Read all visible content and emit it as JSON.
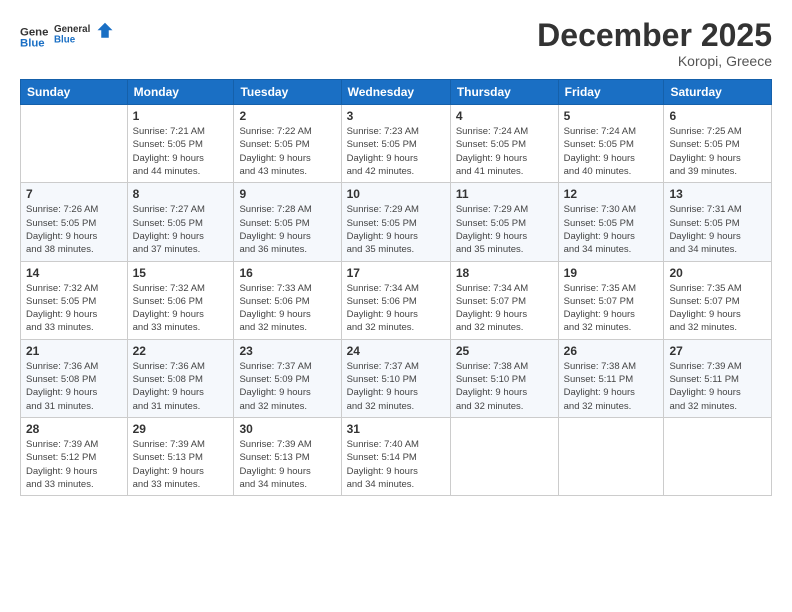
{
  "logo": {
    "line1": "General",
    "line2": "Blue"
  },
  "header": {
    "month": "December 2025",
    "location": "Koropi, Greece"
  },
  "weekdays": [
    "Sunday",
    "Monday",
    "Tuesday",
    "Wednesday",
    "Thursday",
    "Friday",
    "Saturday"
  ],
  "weeks": [
    [
      {
        "day": "",
        "info": ""
      },
      {
        "day": "1",
        "info": "Sunrise: 7:21 AM\nSunset: 5:05 PM\nDaylight: 9 hours\nand 44 minutes."
      },
      {
        "day": "2",
        "info": "Sunrise: 7:22 AM\nSunset: 5:05 PM\nDaylight: 9 hours\nand 43 minutes."
      },
      {
        "day": "3",
        "info": "Sunrise: 7:23 AM\nSunset: 5:05 PM\nDaylight: 9 hours\nand 42 minutes."
      },
      {
        "day": "4",
        "info": "Sunrise: 7:24 AM\nSunset: 5:05 PM\nDaylight: 9 hours\nand 41 minutes."
      },
      {
        "day": "5",
        "info": "Sunrise: 7:24 AM\nSunset: 5:05 PM\nDaylight: 9 hours\nand 40 minutes."
      },
      {
        "day": "6",
        "info": "Sunrise: 7:25 AM\nSunset: 5:05 PM\nDaylight: 9 hours\nand 39 minutes."
      }
    ],
    [
      {
        "day": "7",
        "info": "Sunrise: 7:26 AM\nSunset: 5:05 PM\nDaylight: 9 hours\nand 38 minutes."
      },
      {
        "day": "8",
        "info": "Sunrise: 7:27 AM\nSunset: 5:05 PM\nDaylight: 9 hours\nand 37 minutes."
      },
      {
        "day": "9",
        "info": "Sunrise: 7:28 AM\nSunset: 5:05 PM\nDaylight: 9 hours\nand 36 minutes."
      },
      {
        "day": "10",
        "info": "Sunrise: 7:29 AM\nSunset: 5:05 PM\nDaylight: 9 hours\nand 35 minutes."
      },
      {
        "day": "11",
        "info": "Sunrise: 7:29 AM\nSunset: 5:05 PM\nDaylight: 9 hours\nand 35 minutes."
      },
      {
        "day": "12",
        "info": "Sunrise: 7:30 AM\nSunset: 5:05 PM\nDaylight: 9 hours\nand 34 minutes."
      },
      {
        "day": "13",
        "info": "Sunrise: 7:31 AM\nSunset: 5:05 PM\nDaylight: 9 hours\nand 34 minutes."
      }
    ],
    [
      {
        "day": "14",
        "info": "Sunrise: 7:32 AM\nSunset: 5:05 PM\nDaylight: 9 hours\nand 33 minutes."
      },
      {
        "day": "15",
        "info": "Sunrise: 7:32 AM\nSunset: 5:06 PM\nDaylight: 9 hours\nand 33 minutes."
      },
      {
        "day": "16",
        "info": "Sunrise: 7:33 AM\nSunset: 5:06 PM\nDaylight: 9 hours\nand 32 minutes."
      },
      {
        "day": "17",
        "info": "Sunrise: 7:34 AM\nSunset: 5:06 PM\nDaylight: 9 hours\nand 32 minutes."
      },
      {
        "day": "18",
        "info": "Sunrise: 7:34 AM\nSunset: 5:07 PM\nDaylight: 9 hours\nand 32 minutes."
      },
      {
        "day": "19",
        "info": "Sunrise: 7:35 AM\nSunset: 5:07 PM\nDaylight: 9 hours\nand 32 minutes."
      },
      {
        "day": "20",
        "info": "Sunrise: 7:35 AM\nSunset: 5:07 PM\nDaylight: 9 hours\nand 32 minutes."
      }
    ],
    [
      {
        "day": "21",
        "info": "Sunrise: 7:36 AM\nSunset: 5:08 PM\nDaylight: 9 hours\nand 31 minutes."
      },
      {
        "day": "22",
        "info": "Sunrise: 7:36 AM\nSunset: 5:08 PM\nDaylight: 9 hours\nand 31 minutes."
      },
      {
        "day": "23",
        "info": "Sunrise: 7:37 AM\nSunset: 5:09 PM\nDaylight: 9 hours\nand 32 minutes."
      },
      {
        "day": "24",
        "info": "Sunrise: 7:37 AM\nSunset: 5:10 PM\nDaylight: 9 hours\nand 32 minutes."
      },
      {
        "day": "25",
        "info": "Sunrise: 7:38 AM\nSunset: 5:10 PM\nDaylight: 9 hours\nand 32 minutes."
      },
      {
        "day": "26",
        "info": "Sunrise: 7:38 AM\nSunset: 5:11 PM\nDaylight: 9 hours\nand 32 minutes."
      },
      {
        "day": "27",
        "info": "Sunrise: 7:39 AM\nSunset: 5:11 PM\nDaylight: 9 hours\nand 32 minutes."
      }
    ],
    [
      {
        "day": "28",
        "info": "Sunrise: 7:39 AM\nSunset: 5:12 PM\nDaylight: 9 hours\nand 33 minutes."
      },
      {
        "day": "29",
        "info": "Sunrise: 7:39 AM\nSunset: 5:13 PM\nDaylight: 9 hours\nand 33 minutes."
      },
      {
        "day": "30",
        "info": "Sunrise: 7:39 AM\nSunset: 5:13 PM\nDaylight: 9 hours\nand 34 minutes."
      },
      {
        "day": "31",
        "info": "Sunrise: 7:40 AM\nSunset: 5:14 PM\nDaylight: 9 hours\nand 34 minutes."
      },
      {
        "day": "",
        "info": ""
      },
      {
        "day": "",
        "info": ""
      },
      {
        "day": "",
        "info": ""
      }
    ]
  ]
}
